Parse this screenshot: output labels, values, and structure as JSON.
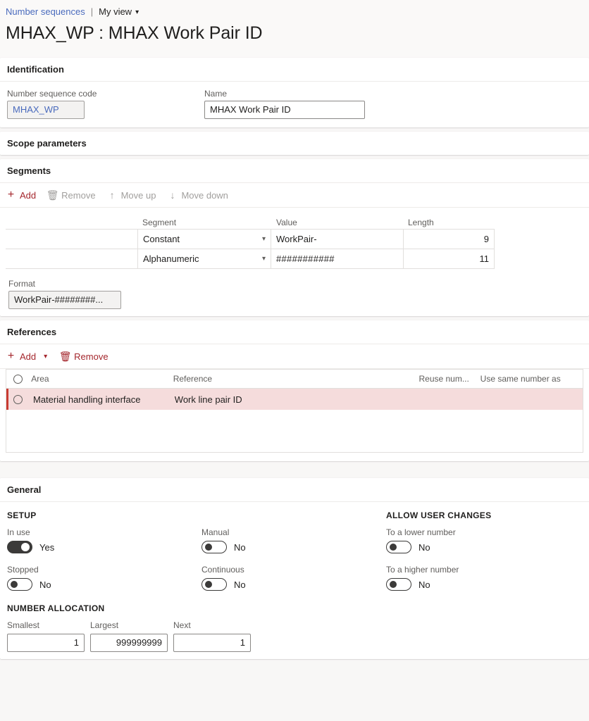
{
  "header": {
    "breadcrumb_link": "Number sequences",
    "separator": "|",
    "view_name": "My view",
    "chevron_icon": "chevron-down-icon",
    "title": "MHAX_WP : MHAX Work Pair ID"
  },
  "identification": {
    "section_title": "Identification",
    "code_label": "Number sequence code",
    "code_value": "MHAX_WP",
    "name_label": "Name",
    "name_value": "MHAX Work Pair ID"
  },
  "scope_parameters": {
    "section_title": "Scope parameters"
  },
  "segments": {
    "section_title": "Segments",
    "toolbar": {
      "add": "Add",
      "remove": "Remove",
      "move_up": "Move up",
      "move_down": "Move down"
    },
    "columns": {
      "blank": "",
      "segment": "Segment",
      "value": "Value",
      "length": "Length"
    },
    "rows": [
      {
        "segment": "Constant",
        "value": "WorkPair-",
        "length": "9"
      },
      {
        "segment": "Alphanumeric",
        "value": "###########",
        "length": "11"
      }
    ],
    "format_label": "Format",
    "format_value": "WorkPair-########..."
  },
  "references": {
    "section_title": "References",
    "toolbar": {
      "add": "Add",
      "remove": "Remove"
    },
    "columns": {
      "area": "Area",
      "reference": "Reference",
      "reuse_numbers": "Reuse num...",
      "use_same_number": "Use same number as"
    },
    "rows": [
      {
        "area": "Material handling interface",
        "reference": "Work line pair ID",
        "reuse_numbers": "",
        "use_same_number": ""
      }
    ]
  },
  "general": {
    "section_title": "General",
    "setup": {
      "group_title": "SETUP",
      "in_use_label": "In use",
      "in_use_value": "Yes",
      "in_use_state": "on",
      "stopped_label": "Stopped",
      "stopped_value": "No",
      "stopped_state": "off",
      "manual_label": "Manual",
      "manual_value": "No",
      "manual_state": "off",
      "continuous_label": "Continuous",
      "continuous_value": "No",
      "continuous_state": "off"
    },
    "allow_user_changes": {
      "group_title": "ALLOW USER CHANGES",
      "lower_label": "To a lower number",
      "lower_value": "No",
      "higher_label": "To a higher number",
      "higher_value": "No"
    },
    "number_allocation": {
      "group_title": "NUMBER ALLOCATION",
      "smallest_label": "Smallest",
      "smallest_value": "1",
      "largest_label": "Largest",
      "largest_value": "999999999",
      "next_label": "Next",
      "next_value": "1"
    }
  },
  "colors": {
    "accent_red": "#a4262c",
    "link_blue": "#4a6bbd",
    "selected_row": "#f5dcdc",
    "selected_marker": "#c83b32"
  }
}
